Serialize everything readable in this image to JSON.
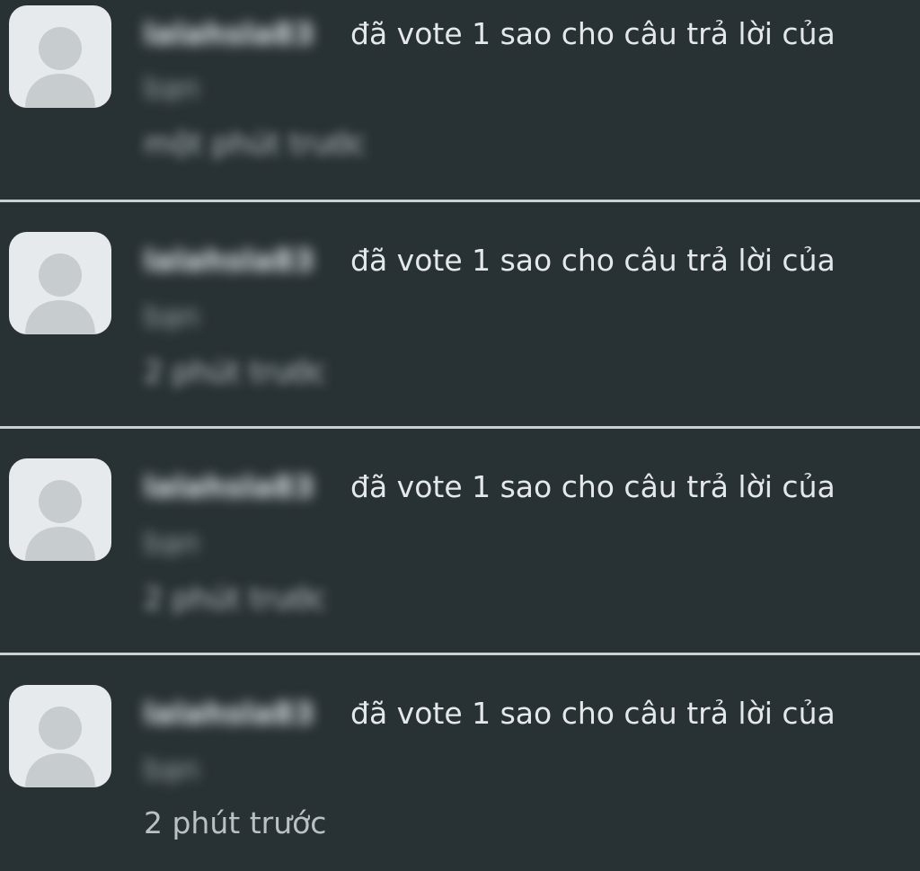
{
  "notifications": [
    {
      "username": "lalahsla83",
      "action": "đã vote 1 sao cho câu trả lời của",
      "target": "bạn",
      "time": "một phút trước"
    },
    {
      "username": "lalahsla83",
      "action": "đã vote 1 sao cho câu trả lời của",
      "target": "bạn",
      "time": "2 phút trước"
    },
    {
      "username": "lalahsla83",
      "action": "đã vote 1 sao cho câu trả lời của",
      "target": "bạn",
      "time": "2 phút trước"
    },
    {
      "username": "lalahsla83",
      "action": "đã vote 1 sao cho câu trả lời của",
      "target": "bạn",
      "time": "2 phút trước"
    }
  ],
  "icons": {
    "avatar": "default-user-avatar-icon"
  },
  "colors": {
    "background": "#283134",
    "divider": "#c9d0d3",
    "avatar_bg": "#e7eaec",
    "avatar_figure": "#c7cccf"
  }
}
